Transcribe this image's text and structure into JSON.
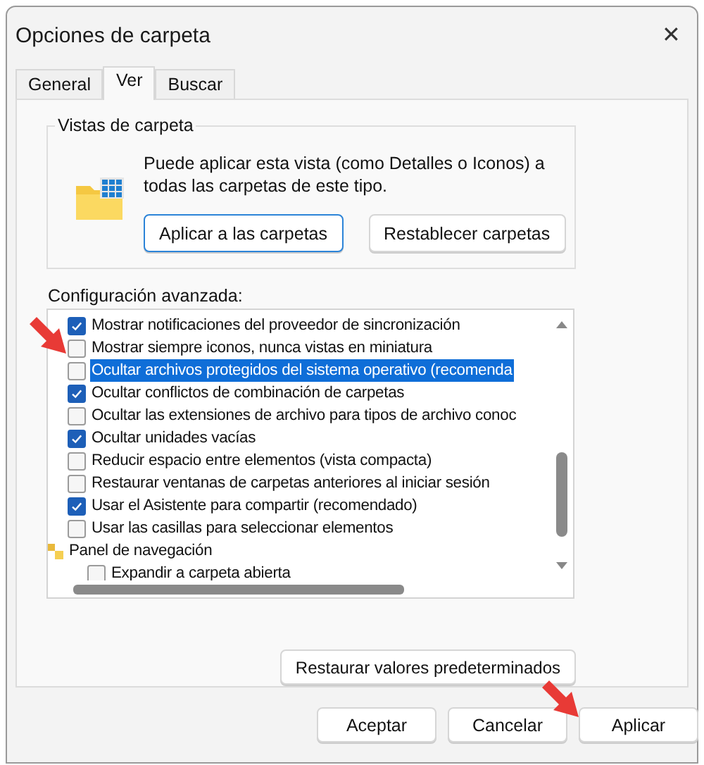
{
  "window": {
    "title": "Opciones de carpeta",
    "close": "✕"
  },
  "tabs": [
    {
      "label": "General",
      "selected": false
    },
    {
      "label": "Ver",
      "selected": true
    },
    {
      "label": "Buscar",
      "selected": false
    }
  ],
  "folder_views": {
    "title": "Vistas de carpeta",
    "description": "Puede aplicar esta vista (como Detalles o Iconos) a todas las carpetas de este tipo.",
    "buttons": [
      {
        "label": "Aplicar a las carpetas",
        "focused": true
      },
      {
        "label": "Restablecer carpetas",
        "focused": false
      }
    ]
  },
  "advanced": {
    "label": "Configuración avanzada:",
    "items": [
      {
        "kind": "checkbox",
        "label": "Mostrar notificaciones del proveedor de sincronización",
        "checked": true,
        "selected": false
      },
      {
        "kind": "checkbox",
        "label": "Mostrar siempre iconos, nunca vistas en miniatura",
        "checked": false,
        "selected": false
      },
      {
        "kind": "checkbox",
        "label": "Ocultar archivos protegidos del sistema operativo (recomenda",
        "checked": false,
        "selected": true
      },
      {
        "kind": "checkbox",
        "label": "Ocultar conflictos de combinación de carpetas",
        "checked": true,
        "selected": false
      },
      {
        "kind": "checkbox",
        "label": "Ocultar las extensiones de archivo para tipos de archivo conoc",
        "checked": false,
        "selected": false
      },
      {
        "kind": "checkbox",
        "label": "Ocultar unidades vacías",
        "checked": true,
        "selected": false
      },
      {
        "kind": "checkbox",
        "label": "Reducir espacio entre elementos (vista compacta)",
        "checked": false,
        "selected": false
      },
      {
        "kind": "checkbox",
        "label": "Restaurar ventanas de carpetas anteriores al iniciar sesión",
        "checked": false,
        "selected": false
      },
      {
        "kind": "checkbox",
        "label": "Usar el Asistente para compartir (recomendado)",
        "checked": true,
        "selected": false
      },
      {
        "kind": "checkbox",
        "label": "Usar las casillas para seleccionar elementos",
        "checked": false,
        "selected": false
      },
      {
        "kind": "group",
        "label": "Panel de navegación",
        "selected": false,
        "children": [
          {
            "kind": "checkbox",
            "label": "Expandir a carpeta abierta",
            "checked": false,
            "selected": false
          }
        ]
      }
    ]
  },
  "restore_button": "Restaurar valores predeterminados",
  "buttons": [
    "Aceptar",
    "Cancelar",
    "Aplicar"
  ]
}
